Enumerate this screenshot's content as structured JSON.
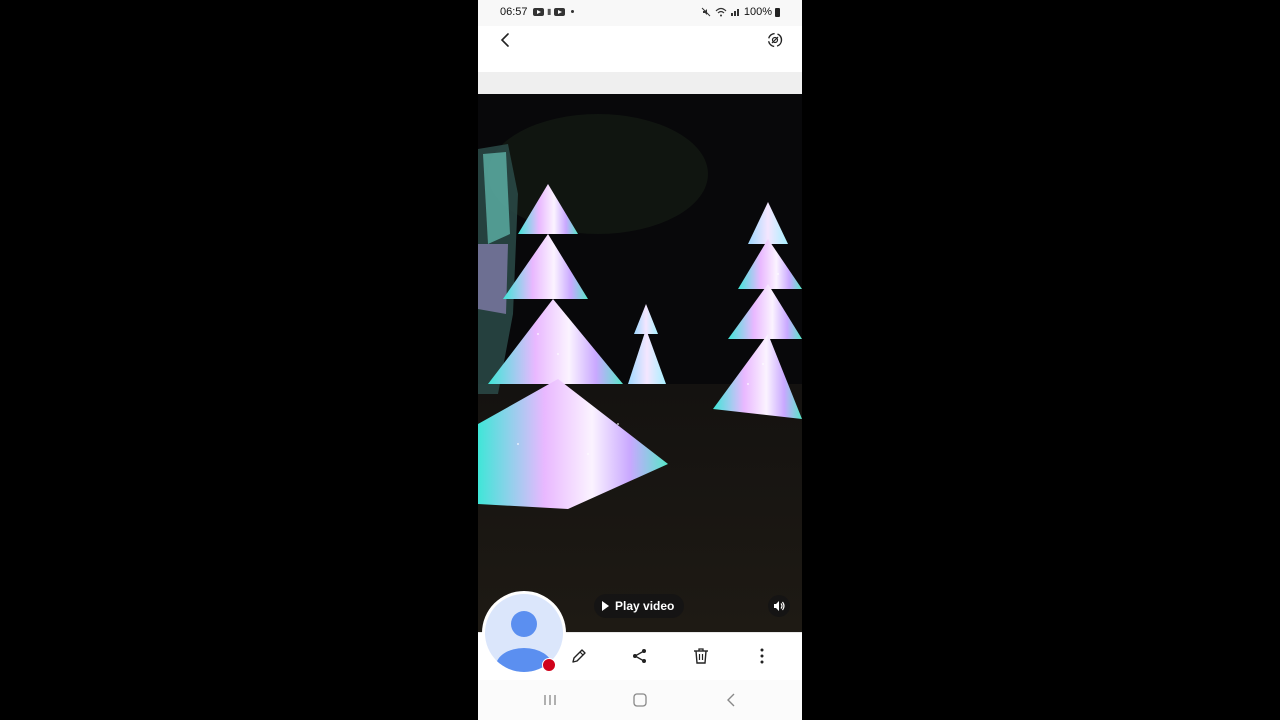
{
  "status_bar": {
    "time": "06:57",
    "battery": "100%"
  },
  "top_bar": {
    "back_icon": "chevron-left-icon",
    "motion_photo_icon": "motion-photo-icon"
  },
  "photo": {
    "description_icon": "christmas-tree-light-photo"
  },
  "overlay": {
    "play_video_label": "Play video",
    "volume_icon": "speaker-icon"
  },
  "bottom_actions": {
    "items": [
      "edit-icon",
      "share-icon",
      "delete-icon",
      "more-icon"
    ]
  },
  "nav_bar": {
    "items": [
      "recent-apps",
      "home",
      "back"
    ]
  },
  "colors": {
    "record_dot": "#d0021b",
    "avatar_bg": "#dbe6fb",
    "avatar_person": "#5b8ff0"
  }
}
